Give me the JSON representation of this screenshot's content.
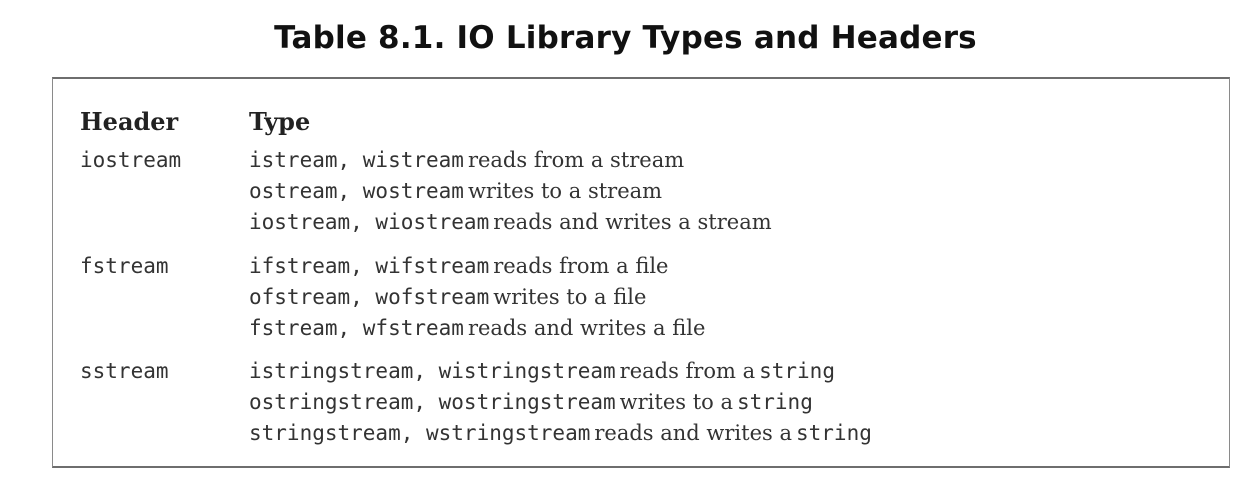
{
  "title": "Table 8.1. IO Library Types and Headers",
  "columns": {
    "header": "Header",
    "type": "Type"
  },
  "groups": [
    {
      "header": "iostream",
      "rows": [
        {
          "types": "istream, wistream",
          "desc": "reads from a stream"
        },
        {
          "types": "ostream, wostream",
          "desc": "writes to a stream"
        },
        {
          "types": "iostream, wiostream",
          "desc": "reads and writes a stream"
        }
      ]
    },
    {
      "header": "fstream",
      "rows": [
        {
          "types": "ifstream, wifstream",
          "desc": "reads from a file"
        },
        {
          "types": "ofstream, wofstream",
          "desc": "writes to a file"
        },
        {
          "types": "fstream, wfstream",
          "desc": "reads and writes a file"
        }
      ]
    },
    {
      "header": "sstream",
      "rows": [
        {
          "types": "istringstream, wistringstream",
          "desc": "reads from a",
          "desc_mono": "string"
        },
        {
          "types": "ostringstream, wostringstream",
          "desc": "writes to a",
          "desc_mono": "string"
        },
        {
          "types": "stringstream, wstringstream",
          "desc": "reads and writes a",
          "desc_mono": "string"
        }
      ]
    }
  ]
}
